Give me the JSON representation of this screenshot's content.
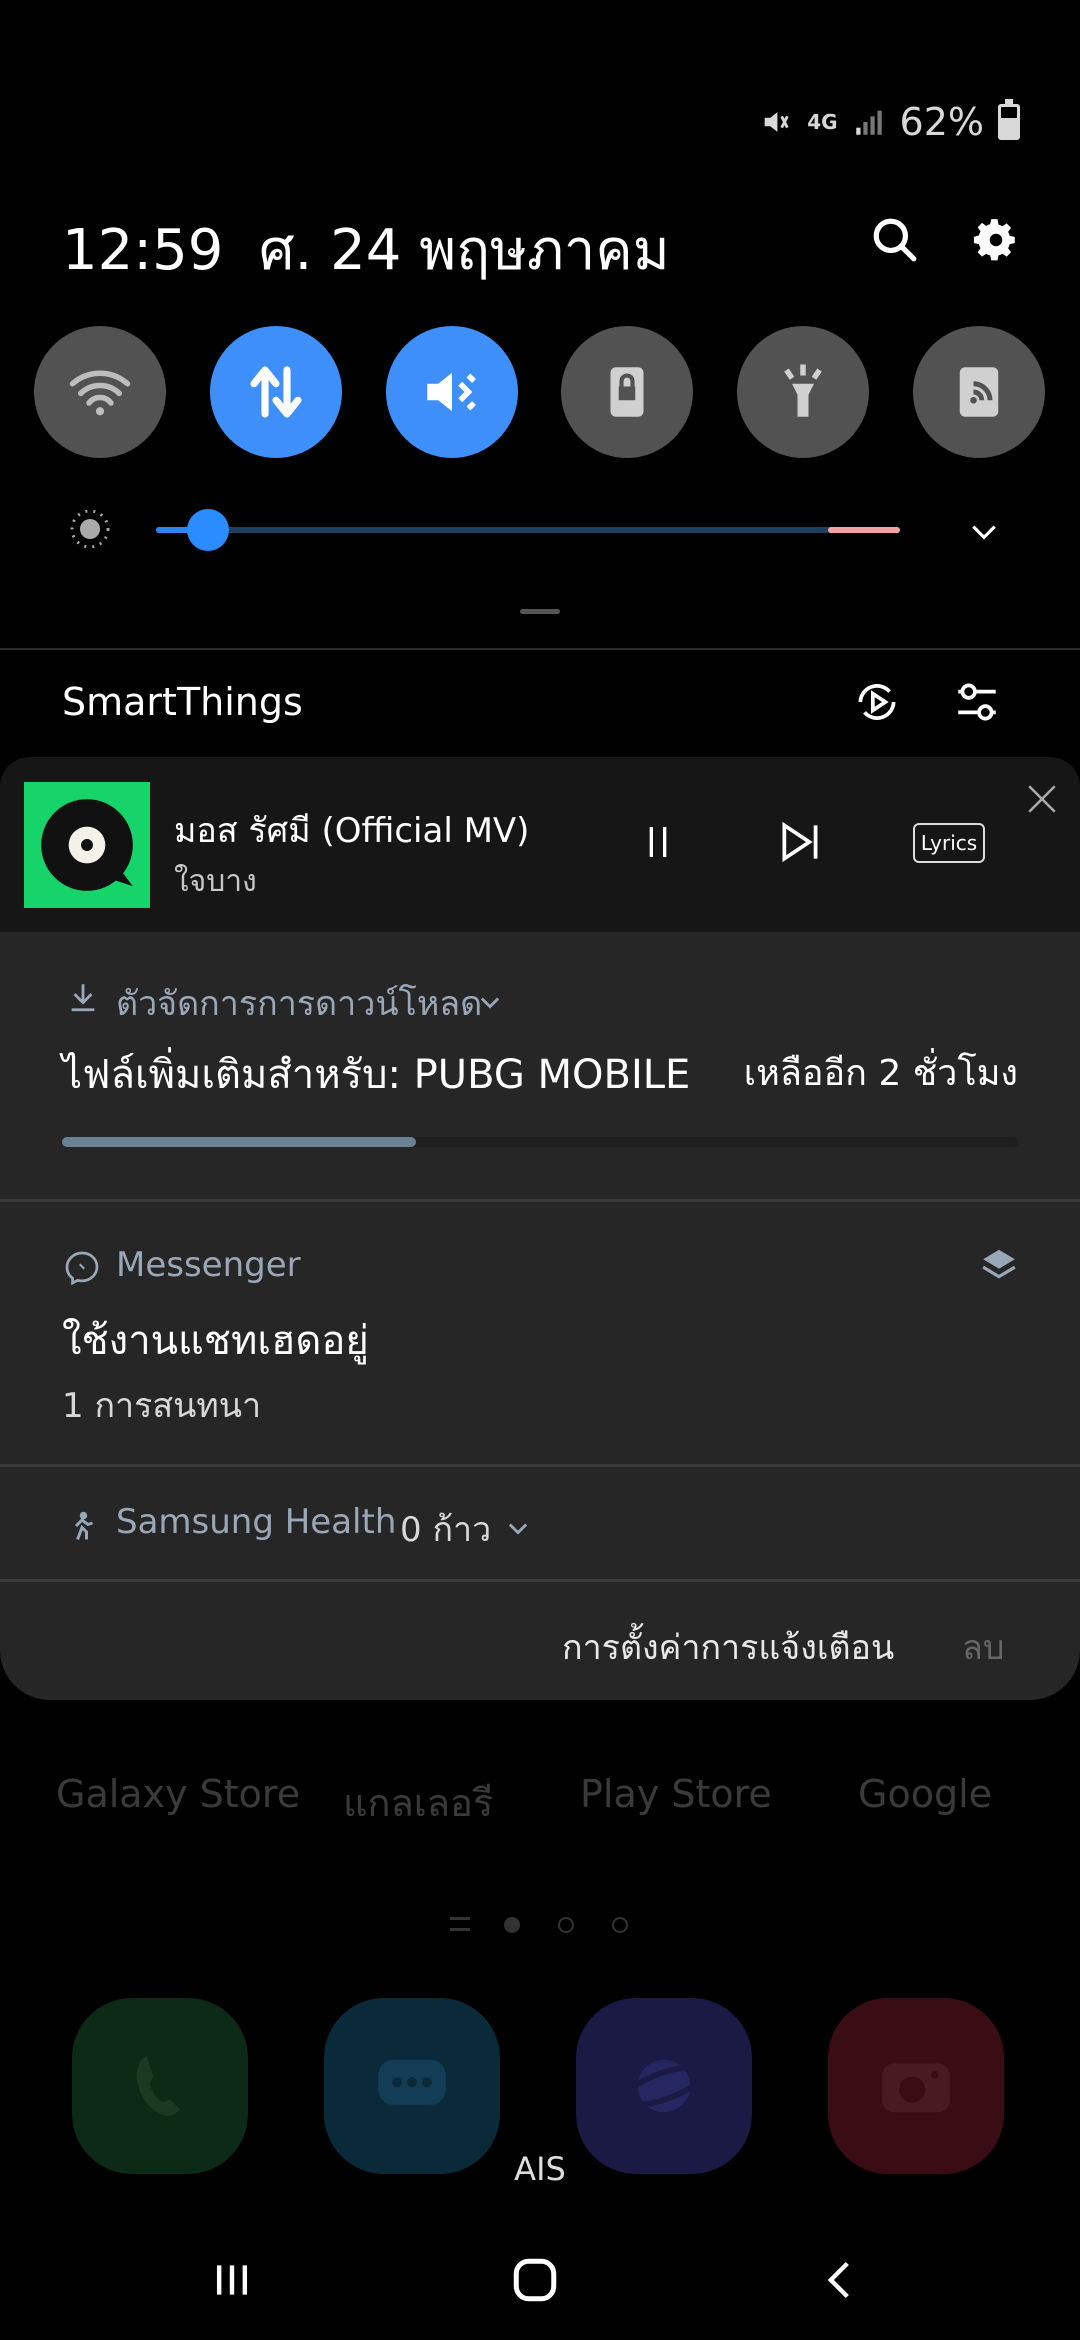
{
  "status_bar": {
    "network": "4G",
    "battery_text": "62%",
    "battery_level": 0.62,
    "icons": [
      "mute-icon",
      "network-4g-icon",
      "signal-icon",
      "battery-icon"
    ]
  },
  "header": {
    "time": "12:59",
    "date": "ศ. 24 พฤษภาคม",
    "search_icon": "search-icon",
    "settings_icon": "gear-icon"
  },
  "quick_tiles": [
    {
      "name": "wifi",
      "icon": "wifi-icon",
      "active": false
    },
    {
      "name": "mobile-data",
      "icon": "data-transfer-icon",
      "active": true
    },
    {
      "name": "sound-mode",
      "icon": "mute-icon",
      "active": true
    },
    {
      "name": "rotation-lock",
      "icon": "lock-icon",
      "active": false
    },
    {
      "name": "flashlight",
      "icon": "flashlight-icon",
      "active": false
    },
    {
      "name": "nfc",
      "icon": "nfc-icon",
      "active": false
    }
  ],
  "brightness": {
    "level": 0.07
  },
  "smartthings": {
    "title": "SmartThings"
  },
  "media": {
    "song": "มอส รัศมี (Official MV)",
    "artist": "ใจบาง",
    "lyrics_label": "Lyrics",
    "accent": "#17d46a"
  },
  "notifications": {
    "download": {
      "app": "ตัวจัดการการดาวน์โหลด",
      "title": "ไฟล์เพิ่มเติมสำหรับ: PUBG MOBILE",
      "remaining": "เหลืออีก 2 ชั่วโมง",
      "progress": 0.37
    },
    "messenger": {
      "app": "Messenger",
      "title": "ใช้งานแชทเฮดอยู่",
      "subtitle": "1 การสนทนา"
    },
    "health": {
      "app": "Samsung Health",
      "steps": "0 ก้าว"
    },
    "footer": {
      "settings_label": "การตั้งค่าการแจ้งเตือน",
      "clear_label": "ลบ"
    }
  },
  "home_screen": {
    "apps": [
      "Galaxy Store",
      "แกลเลอรี",
      "Play Store",
      "Google"
    ],
    "carrier": "AIS"
  }
}
